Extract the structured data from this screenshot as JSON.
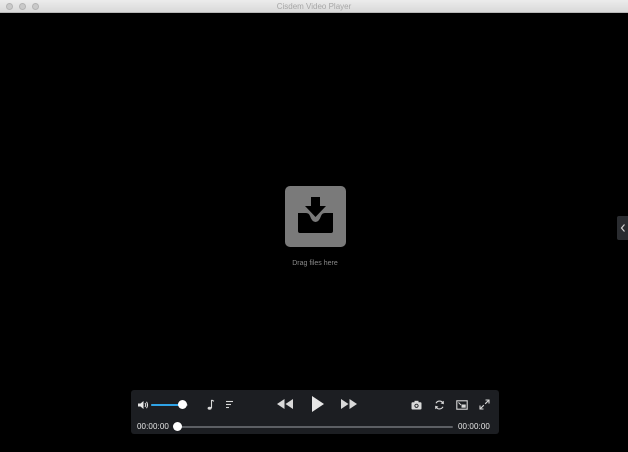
{
  "window": {
    "title": "Cisdem Video Player"
  },
  "drop_zone": {
    "text": "Drag files here"
  },
  "controls": {
    "volume_level": 0.85,
    "playback_progress": 0,
    "current_time": "00:00:00",
    "total_time": "00:00:00",
    "accent_color": "#2fa3e6",
    "icons": [
      "volume-icon",
      "music-note-icon",
      "playlist-icon",
      "rewind-icon",
      "play-icon",
      "fast-forward-icon",
      "camera-icon",
      "rotate-icon",
      "pip-icon",
      "fullscreen-icon"
    ]
  }
}
